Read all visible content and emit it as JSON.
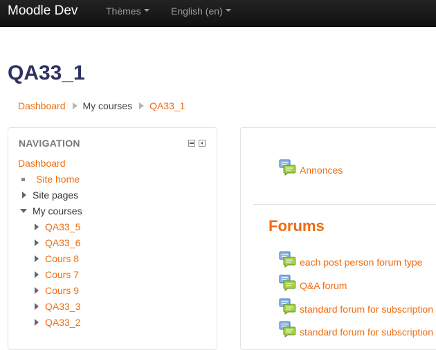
{
  "navbar": {
    "brand": "Moodle Dev",
    "menus": [
      {
        "label": "Thèmes"
      },
      {
        "label": "English (en)"
      }
    ]
  },
  "page": {
    "title": "QA33_1"
  },
  "breadcrumb": [
    {
      "label": "Dashboard",
      "link": true
    },
    {
      "label": "My courses",
      "link": false
    },
    {
      "label": "QA33_1",
      "link": true
    }
  ],
  "navigation": {
    "title": "NAVIGATION",
    "items": [
      {
        "label": "Dashboard",
        "marker": "none",
        "link": true
      },
      {
        "label": "Site home",
        "marker": "bullet",
        "link": true
      },
      {
        "label": "Site pages",
        "marker": "collapsed",
        "link": false
      },
      {
        "label": "My courses",
        "marker": "expanded",
        "link": false
      },
      {
        "label": "QA33_5",
        "marker": "collapsed",
        "link": true
      },
      {
        "label": "QA33_6",
        "marker": "collapsed",
        "link": true
      },
      {
        "label": "Cours 8",
        "marker": "collapsed",
        "link": true
      },
      {
        "label": "Cours 7",
        "marker": "collapsed",
        "link": true
      },
      {
        "label": "Cours 9",
        "marker": "collapsed",
        "link": true
      },
      {
        "label": "QA33_3",
        "marker": "collapsed",
        "link": true
      },
      {
        "label": "QA33_2",
        "marker": "collapsed",
        "link": true
      }
    ]
  },
  "main": {
    "general_activity": {
      "label": "Annonces",
      "icon": "forum-icon"
    },
    "section_title": "Forums",
    "activities": [
      {
        "label": "each post person forum type",
        "icon": "forum-icon"
      },
      {
        "label": "Q&A forum",
        "icon": "forum-icon"
      },
      {
        "label": "standard forum for subscription",
        "icon": "forum-icon"
      },
      {
        "label": "standard forum for subscription",
        "icon": "forum-icon"
      }
    ]
  },
  "colors": {
    "link": "#f06c0f",
    "title": "#2e3261",
    "navbar": "#1b1b1b"
  }
}
